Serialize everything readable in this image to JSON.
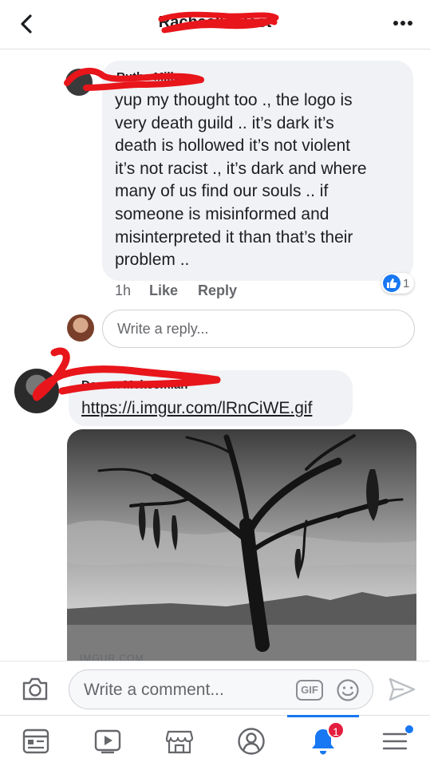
{
  "header": {
    "title": "Rachael's Post",
    "back_icon": "chevron-left-icon",
    "more_icon": "more-horizontal-icon"
  },
  "comments": [
    {
      "author": "Ruthe Miller",
      "text": "yup my thought too ., the logo is\nvery death guild .. it’s dark it’s\ndeath is hollowed it’s not violent\nit’s not racist ., it’s dark and where\nmany of us find our souls .. if\nsomeone is misinformed and\nmisinterpreted it than that’s their\nproblem ..",
      "time": "1h",
      "like_label": "Like",
      "reply_label": "Reply",
      "reaction_count": "1"
    },
    {
      "author": "Darren Mckeemian",
      "link": "https://i.imgur.com/lRnCiWE.gif",
      "source_label": "IMGUR.COM"
    }
  ],
  "reply_input": {
    "placeholder": "Write a reply..."
  },
  "composer": {
    "placeholder": "Write a comment...",
    "gif_label": "GIF"
  },
  "tabbar": {
    "notifications_badge": "1"
  },
  "colors": {
    "accent": "#1877f2",
    "scribble": "#e8151b",
    "badge": "#e41e3f"
  }
}
